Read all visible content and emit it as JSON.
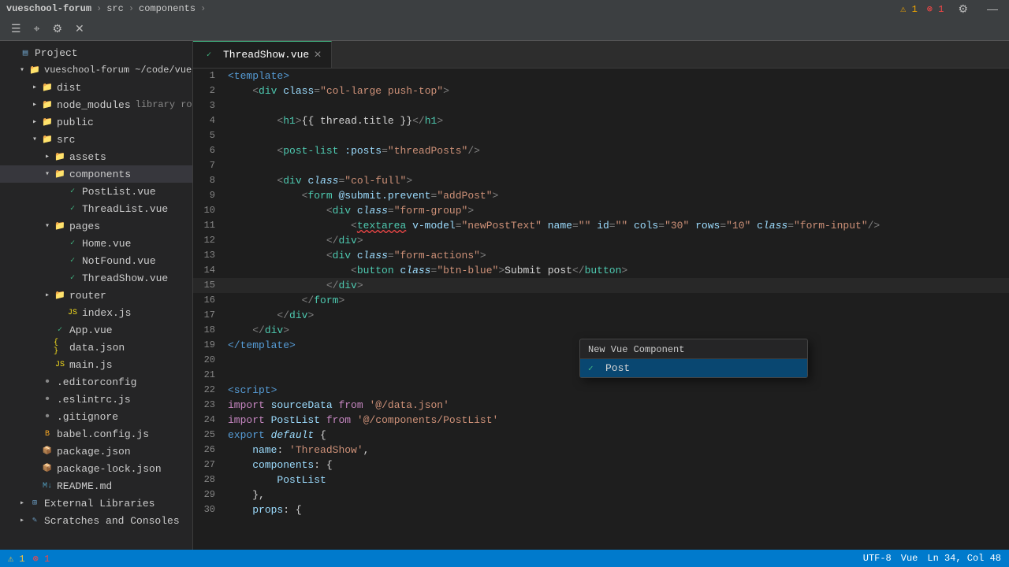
{
  "titlebar": {
    "project": "vueschool-forum",
    "breadcrumb": [
      "src",
      "components"
    ],
    "icons": {
      "settings": "⚙",
      "minimize": "—",
      "warnings": "⚠ 1",
      "errors": "⊘ 1"
    }
  },
  "sidebar": {
    "project_label": "Project",
    "items": [
      {
        "id": "root",
        "label": "vueschool-forum ~/code/vuesch",
        "indent": 1,
        "arrow": "open",
        "icon": "folder",
        "icon_class": "folder-icon-orange"
      },
      {
        "id": "dist",
        "label": "dist",
        "indent": 2,
        "arrow": "closed",
        "icon": "folder",
        "icon_class": "folder-icon-orange"
      },
      {
        "id": "node_modules",
        "label": "node_modules",
        "indent": 2,
        "arrow": "closed",
        "icon": "folder",
        "icon_class": "folder-icon-orange",
        "extra": "library root"
      },
      {
        "id": "public",
        "label": "public",
        "indent": 2,
        "arrow": "closed",
        "icon": "folder",
        "icon_class": "folder-icon-orange"
      },
      {
        "id": "src",
        "label": "src",
        "indent": 2,
        "arrow": "open",
        "icon": "folder",
        "icon_class": "folder-icon-orange"
      },
      {
        "id": "assets",
        "label": "assets",
        "indent": 3,
        "arrow": "closed",
        "icon": "folder",
        "icon_class": "folder-icon-orange"
      },
      {
        "id": "components",
        "label": "components",
        "indent": 3,
        "arrow": "open",
        "icon": "folder",
        "icon_class": "folder-icon-blue",
        "selected": true
      },
      {
        "id": "PostList.vue",
        "label": "PostList.vue",
        "indent": 4,
        "arrow": "none",
        "icon": "vue",
        "icon_class": "vue-icon"
      },
      {
        "id": "ThreadList.vue",
        "label": "ThreadList.vue",
        "indent": 4,
        "arrow": "none",
        "icon": "vue",
        "icon_class": "vue-icon"
      },
      {
        "id": "pages",
        "label": "pages",
        "indent": 3,
        "arrow": "open",
        "icon": "folder",
        "icon_class": "folder-icon-orange"
      },
      {
        "id": "Home.vue",
        "label": "Home.vue",
        "indent": 4,
        "arrow": "none",
        "icon": "vue",
        "icon_class": "vue-icon"
      },
      {
        "id": "NotFound.vue",
        "label": "NotFound.vue",
        "indent": 4,
        "arrow": "none",
        "icon": "vue",
        "icon_class": "vue-icon"
      },
      {
        "id": "ThreadShow.vue",
        "label": "ThreadShow.vue",
        "indent": 4,
        "arrow": "none",
        "icon": "vue",
        "icon_class": "vue-icon"
      },
      {
        "id": "router",
        "label": "router",
        "indent": 3,
        "arrow": "closed",
        "icon": "folder",
        "icon_class": "folder-icon-orange"
      },
      {
        "id": "index.js",
        "label": "index.js",
        "indent": 4,
        "arrow": "none",
        "icon": "js",
        "icon_class": "js-icon"
      },
      {
        "id": "App.vue",
        "label": "App.vue",
        "indent": 3,
        "arrow": "none",
        "icon": "vue",
        "icon_class": "vue-icon"
      },
      {
        "id": "data.json",
        "label": "data.json",
        "indent": 3,
        "arrow": "none",
        "icon": "json",
        "icon_class": "json-icon"
      },
      {
        "id": "main.js",
        "label": "main.js",
        "indent": 3,
        "arrow": "none",
        "icon": "js",
        "icon_class": "js-icon"
      },
      {
        "id": ".editorconfig",
        "label": ".editorconfig",
        "indent": 2,
        "arrow": "none",
        "icon": "dot",
        "icon_class": "gitignore-icon"
      },
      {
        "id": ".eslintrc.js",
        "label": ".eslintrc.js",
        "indent": 2,
        "arrow": "none",
        "icon": "dot",
        "icon_class": "js-icon"
      },
      {
        "id": ".gitignore",
        "label": ".gitignore",
        "indent": 2,
        "arrow": "none",
        "icon": "dot",
        "icon_class": "gitignore-icon"
      },
      {
        "id": "babel.config.js",
        "label": "babel.config.js",
        "indent": 2,
        "arrow": "none",
        "icon": "babel",
        "icon_class": "babel-icon"
      },
      {
        "id": "package.json",
        "label": "package.json",
        "indent": 2,
        "arrow": "none",
        "icon": "pkg",
        "icon_class": "pkg-icon"
      },
      {
        "id": "package-lock.json",
        "label": "package-lock.json",
        "indent": 2,
        "arrow": "none",
        "icon": "pkg",
        "icon_class": "pkg-icon"
      },
      {
        "id": "README.md",
        "label": "README.md",
        "indent": 2,
        "arrow": "none",
        "icon": "md",
        "icon_class": "md-icon"
      },
      {
        "id": "External Libraries",
        "label": "External Libraries",
        "indent": 1,
        "arrow": "closed",
        "icon": "ext",
        "icon_class": "ext-lib-icon"
      },
      {
        "id": "Scratches and Consoles",
        "label": "Scratches and Consoles",
        "indent": 1,
        "arrow": "closed",
        "icon": "ext",
        "icon_class": "ext-lib-icon"
      }
    ]
  },
  "tabs": [
    {
      "id": "ThreadShow.vue",
      "label": "ThreadShow.vue",
      "active": true,
      "icon_class": "vue-icon"
    }
  ],
  "autocomplete": {
    "header": "New Vue Component",
    "items": [
      {
        "label": "Post",
        "icon": "✓",
        "selected": true
      }
    ]
  },
  "statusbar": {
    "warnings": "⚠ 1",
    "errors": "⊗ 1",
    "right": [
      "UTF-8",
      "Vue",
      "Ln 34, Col 48"
    ]
  },
  "code_lines": [
    {
      "num": 1,
      "content": "<template>",
      "tokens": [
        {
          "text": "<template>",
          "class": "c-template"
        }
      ]
    },
    {
      "num": 2,
      "content": "    <div class=\"col-large push-top\">",
      "tokens": [
        {
          "text": "    "
        },
        {
          "text": "<",
          "class": "c-punct"
        },
        {
          "text": "div",
          "class": "c-tag"
        },
        {
          "text": " "
        },
        {
          "text": "class",
          "class": "c-attr"
        },
        {
          "text": "=",
          "class": "c-punct"
        },
        {
          "text": "\"col-large push-top\"",
          "class": "c-string"
        },
        {
          "text": ">",
          "class": "c-punct"
        }
      ]
    },
    {
      "num": 3,
      "content": ""
    },
    {
      "num": 4,
      "content": "        <h1>{{ thread.title }}</h1>",
      "tokens": [
        {
          "text": "        "
        },
        {
          "text": "<",
          "class": "c-punct"
        },
        {
          "text": "h1",
          "class": "c-tag"
        },
        {
          "text": ">",
          "class": "c-punct"
        },
        {
          "text": "{{ thread.title }}",
          "class": "c-mustache"
        },
        {
          "text": "</",
          "class": "c-punct"
        },
        {
          "text": "h1",
          "class": "c-tag"
        },
        {
          "text": ">",
          "class": "c-punct"
        }
      ]
    },
    {
      "num": 5,
      "content": ""
    },
    {
      "num": 6,
      "content": "        <post-list :posts=\"threadPosts\"/>",
      "tokens": [
        {
          "text": "        "
        },
        {
          "text": "<",
          "class": "c-punct"
        },
        {
          "text": "post-list",
          "class": "c-tag"
        },
        {
          "text": " "
        },
        {
          "text": ":posts",
          "class": "c-attr"
        },
        {
          "text": "=",
          "class": "c-punct"
        },
        {
          "text": "\"threadPosts\"",
          "class": "c-string"
        },
        {
          "text": "/>",
          "class": "c-punct"
        }
      ]
    },
    {
      "num": 7,
      "content": ""
    },
    {
      "num": 8,
      "content": "        <div class=\"col-full\">",
      "tokens": [
        {
          "text": "        "
        },
        {
          "text": "<",
          "class": "c-punct"
        },
        {
          "text": "div",
          "class": "c-tag"
        },
        {
          "text": " "
        },
        {
          "text": "class",
          "class": "c-attr"
        },
        {
          "text": "=",
          "class": "c-punct"
        },
        {
          "text": "\"col-full\"",
          "class": "c-string"
        },
        {
          "text": ">",
          "class": "c-punct"
        }
      ]
    },
    {
      "num": 9,
      "content": "            <form @submit.prevent=\"addPost\">",
      "tokens": [
        {
          "text": "            "
        },
        {
          "text": "<",
          "class": "c-punct"
        },
        {
          "text": "form",
          "class": "c-tag"
        },
        {
          "text": " "
        },
        {
          "text": "@submit.prevent",
          "class": "c-attr"
        },
        {
          "text": "=",
          "class": "c-punct"
        },
        {
          "text": "\"addPost\"",
          "class": "c-string"
        },
        {
          "text": ">",
          "class": "c-punct"
        }
      ]
    },
    {
      "num": 10,
      "content": "                <div class=\"form-group\">",
      "tokens": [
        {
          "text": "                "
        },
        {
          "text": "<",
          "class": "c-punct"
        },
        {
          "text": "div",
          "class": "c-tag"
        },
        {
          "text": " "
        },
        {
          "text": "class",
          "class": "c-attr"
        },
        {
          "text": "=",
          "class": "c-punct"
        },
        {
          "text": "\"form-group\"",
          "class": "c-string"
        },
        {
          "text": ">",
          "class": "c-punct"
        }
      ]
    },
    {
      "num": 11,
      "content": "                    <textarea v-model=\"newPostText\" name=\"\" id=\"\" cols=\"30\" rows=\"10\" class=\"form-input\"/>",
      "tokens": [
        {
          "text": "                    "
        },
        {
          "text": "<",
          "class": "c-punct"
        },
        {
          "text": "textarea",
          "class": "c-tag"
        },
        {
          "text": " "
        },
        {
          "text": "v-model",
          "class": "c-attr",
          "squiggly": true
        },
        {
          "text": "=",
          "class": "c-punct"
        },
        {
          "text": "\"newPostText\"",
          "class": "c-string"
        },
        {
          "text": " "
        },
        {
          "text": "name",
          "class": "c-attr"
        },
        {
          "text": "=",
          "class": "c-punct"
        },
        {
          "text": "\"\"",
          "class": "c-string"
        },
        {
          "text": " "
        },
        {
          "text": "id",
          "class": "c-attr"
        },
        {
          "text": "=",
          "class": "c-punct"
        },
        {
          "text": "\"\"",
          "class": "c-string"
        },
        {
          "text": " "
        },
        {
          "text": "cols",
          "class": "c-attr"
        },
        {
          "text": "=",
          "class": "c-punct"
        },
        {
          "text": "\"30\"",
          "class": "c-string"
        },
        {
          "text": " "
        },
        {
          "text": "rows",
          "class": "c-attr"
        },
        {
          "text": "=",
          "class": "c-punct"
        },
        {
          "text": "\"10\"",
          "class": "c-string"
        },
        {
          "text": " "
        },
        {
          "text": "class",
          "class": "c-attr"
        },
        {
          "text": "=",
          "class": "c-punct"
        },
        {
          "text": "\"form-input\"",
          "class": "c-string"
        },
        {
          "text": "/>",
          "class": "c-punct"
        }
      ]
    },
    {
      "num": 12,
      "content": "                </div>",
      "tokens": [
        {
          "text": "                "
        },
        {
          "text": "</",
          "class": "c-punct"
        },
        {
          "text": "div",
          "class": "c-tag"
        },
        {
          "text": ">",
          "class": "c-punct"
        }
      ]
    },
    {
      "num": 13,
      "content": "                <div class=\"form-actions\">",
      "tokens": [
        {
          "text": "                "
        },
        {
          "text": "<",
          "class": "c-punct"
        },
        {
          "text": "div",
          "class": "c-tag"
        },
        {
          "text": " "
        },
        {
          "text": "class",
          "class": "c-attr"
        },
        {
          "text": "=",
          "class": "c-punct"
        },
        {
          "text": "\"form-actions\"",
          "class": "c-string"
        },
        {
          "text": ">",
          "class": "c-punct"
        }
      ]
    },
    {
      "num": 14,
      "content": "                    <button class=\"btn-blue\">Submit post</button>",
      "tokens": [
        {
          "text": "                    "
        },
        {
          "text": "<",
          "class": "c-punct"
        },
        {
          "text": "button",
          "class": "c-tag"
        },
        {
          "text": " "
        },
        {
          "text": "class",
          "class": "c-attr"
        },
        {
          "text": "=",
          "class": "c-punct"
        },
        {
          "text": "\"btn-blue\"",
          "class": "c-string"
        },
        {
          "text": ">",
          "class": "c-punct"
        },
        {
          "text": "Submit post",
          "class": "c-text"
        },
        {
          "text": "</",
          "class": "c-punct"
        },
        {
          "text": "button",
          "class": "c-tag"
        },
        {
          "text": ">",
          "class": "c-punct"
        }
      ]
    },
    {
      "num": 15,
      "content": "                </div>",
      "tokens": [
        {
          "text": "                "
        },
        {
          "text": "</",
          "class": "c-punct"
        },
        {
          "text": "div",
          "class": "c-tag"
        },
        {
          "text": ">",
          "class": "c-punct"
        }
      ]
    },
    {
      "num": 16,
      "content": "            </form>",
      "tokens": [
        {
          "text": "            "
        },
        {
          "text": "</",
          "class": "c-punct"
        },
        {
          "text": "form",
          "class": "c-tag"
        },
        {
          "text": ">",
          "class": "c-punct"
        }
      ]
    },
    {
      "num": 17,
      "content": "        </div>",
      "tokens": [
        {
          "text": "        "
        },
        {
          "text": "</",
          "class": "c-punct"
        },
        {
          "text": "div",
          "class": "c-tag"
        },
        {
          "text": ">",
          "class": "c-punct"
        }
      ]
    },
    {
      "num": 18,
      "content": "    </div>",
      "tokens": [
        {
          "text": "    "
        },
        {
          "text": "</",
          "class": "c-punct"
        },
        {
          "text": "div",
          "class": "c-tag"
        },
        {
          "text": ">",
          "class": "c-punct"
        }
      ]
    },
    {
      "num": 19,
      "content": "</template>",
      "tokens": [
        {
          "text": "</template>",
          "class": "c-template"
        }
      ]
    },
    {
      "num": 20,
      "content": ""
    },
    {
      "num": 21,
      "content": ""
    },
    {
      "num": 22,
      "content": "<script>",
      "tokens": [
        {
          "text": "<script>",
          "class": "c-template"
        }
      ]
    },
    {
      "num": 23,
      "content": "import sourceData from '@/data.json'",
      "tokens": [
        {
          "text": "import",
          "class": "c-import"
        },
        {
          "text": " "
        },
        {
          "text": "sourceData",
          "class": "c-var"
        },
        {
          "text": " "
        },
        {
          "text": "from",
          "class": "c-from"
        },
        {
          "text": " "
        },
        {
          "text": "'@/data.json'",
          "class": "c-string"
        }
      ]
    },
    {
      "num": 24,
      "content": "import PostList from '@/components/PostList'",
      "tokens": [
        {
          "text": "import",
          "class": "c-import"
        },
        {
          "text": " "
        },
        {
          "text": "PostList",
          "class": "c-var"
        },
        {
          "text": " "
        },
        {
          "text": "from",
          "class": "c-from"
        },
        {
          "text": " "
        },
        {
          "text": "'@/components/PostList'",
          "class": "c-string"
        }
      ]
    },
    {
      "num": 25,
      "content": "export default {",
      "tokens": [
        {
          "text": "export",
          "class": "c-keyword"
        },
        {
          "text": " "
        },
        {
          "text": "default",
          "class": "c-italic"
        },
        {
          "text": " {"
        }
      ]
    },
    {
      "num": 26,
      "content": "    name: 'ThreadShow',",
      "tokens": [
        {
          "text": "    "
        },
        {
          "text": "name",
          "class": "c-var"
        },
        {
          "text": ": "
        },
        {
          "text": "'ThreadShow'",
          "class": "c-string"
        },
        {
          "text": ","
        }
      ]
    },
    {
      "num": 27,
      "content": "    components: {",
      "tokens": [
        {
          "text": "    "
        },
        {
          "text": "components",
          "class": "c-var"
        },
        {
          "text": ": {"
        }
      ]
    },
    {
      "num": 28,
      "content": "        PostList",
      "tokens": [
        {
          "text": "        "
        },
        {
          "text": "PostList",
          "class": "c-var"
        }
      ]
    },
    {
      "num": 29,
      "content": "    },",
      "tokens": [
        {
          "text": "    },"
        }
      ]
    },
    {
      "num": 30,
      "content": "    props: {",
      "tokens": [
        {
          "text": "    "
        },
        {
          "text": "props",
          "class": "c-var"
        },
        {
          "text": ": {"
        }
      ]
    }
  ]
}
